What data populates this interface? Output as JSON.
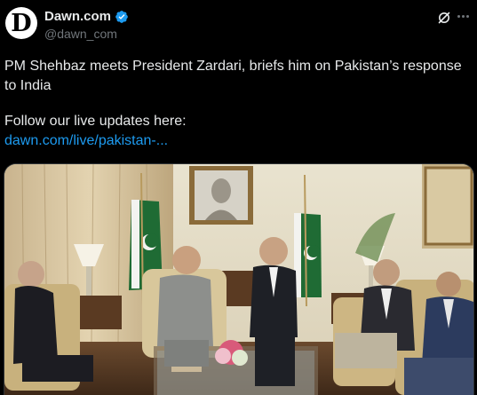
{
  "account": {
    "avatar_letter": "D",
    "display_name": "Dawn.com",
    "handle": "@dawn_com",
    "verified": true,
    "verified_color": "#1d9bf0"
  },
  "actions": {
    "grok_icon": "grok-slash-icon",
    "more_icon": "more-horizontal-icon"
  },
  "tweet": {
    "text_line1": "PM Shehbaz meets President Zardari, briefs him on Pakistan’s response to India",
    "text_line2": "Follow our live updates here:",
    "link_text": "dawn.com/live/pakistan-...",
    "link_color": "#1d9bf0"
  },
  "media": {
    "type": "photo",
    "description_icon": "meeting-photo"
  }
}
